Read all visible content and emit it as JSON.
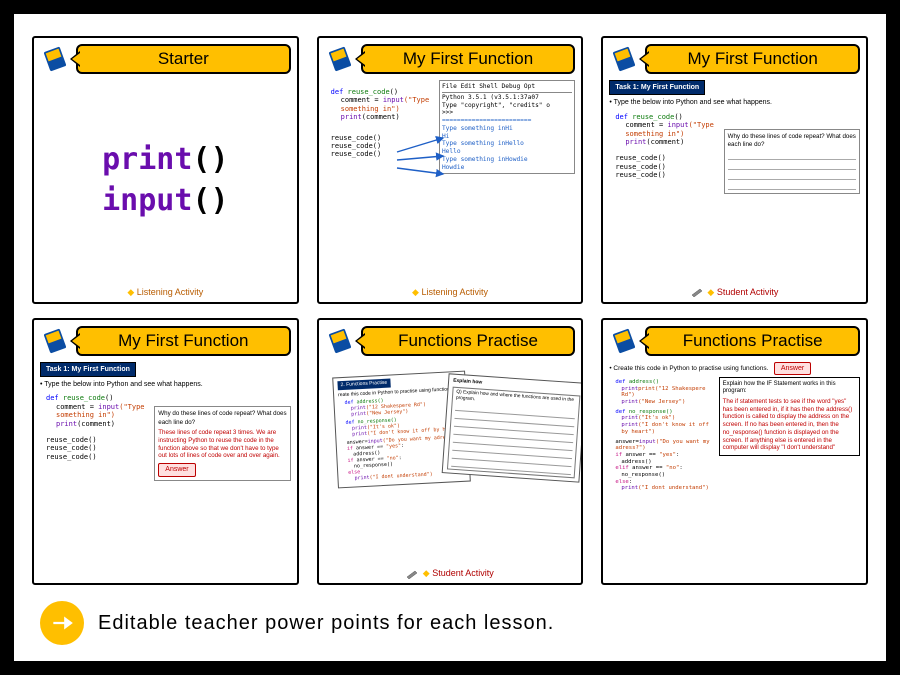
{
  "slides": [
    {
      "title": "Starter",
      "funcs": {
        "f1": "print",
        "f2": "input",
        "par": "()"
      },
      "footer": "Listening Activity"
    },
    {
      "title": "My First Function",
      "code_left": {
        "l1a": "def ",
        "l1b": "reuse_code",
        "l1c": "()",
        "l2a": "comment = ",
        "l2b": "input",
        "l2c": "(\"Type something in\")",
        "l3a": "print",
        "l3b": "(comment)",
        "calls": "reuse_code()"
      },
      "ide": {
        "menu": "File  Edit  Shell  Debug  Opt",
        "head1": "Python 3.5.1 (v3.5.1:37a07",
        "head2": "Type \"copyright\", \"credits\" o",
        "prompt": ">>>",
        "sep": "========================",
        "l1": "Type something inHi",
        "l2": "Hi",
        "l3": "Type something inHello",
        "l4": "Hello",
        "l5": "Type something inHowdie",
        "l6": "Howdie"
      },
      "footer": "Listening Activity"
    },
    {
      "title": "My First Function",
      "task": "Task 1: My First Function",
      "bullet": "Type the below into Python and see what happens.",
      "question": "Why do these lines of code repeat?  What does each line do?",
      "footer": "Student Activity"
    },
    {
      "title": "My First Function",
      "task": "Task 1: My First Function",
      "bullet": "Type the below into Python and see what happens.",
      "question": "Why do these lines of code repeat?  What does each line do?",
      "answer_text": "These lines of code repeat 3 times. We are instructing Python to reuse the code in the function above so that we don't have to type out lots of lines of code over and over again.",
      "answer_btn": "Answer",
      "footer": ""
    },
    {
      "title": "Functions Practise",
      "sheet_task": "2. Functions Practise",
      "sheet_l1": "reate this code in Python to practise using function",
      "sheet_l2": "Q) Explain how and where the functions are used in the program.",
      "sheet_explain": "Explain how",
      "code": {
        "d1": "def address()",
        "p1": "print(\"12 Shakespere Rd\")",
        "p2": "print(\"New Jersey\")",
        "d2": "def no_response()",
        "p3": "print(\"It's ok\")",
        "p4": "print(\"I don't know it off by hear\")",
        "a1": "answer=input(\"Do you want my adress?\")",
        "if1": "if answer == \"yes\":",
        "c1": "address()",
        "if2": "if answer == \"no\":",
        "c2": "no_response()",
        "el": "else",
        "p5": "print(\"I dont understand\")"
      },
      "footer": "Student Activity"
    },
    {
      "title": "Functions Practise",
      "bullet": "Create this code in Python to practise using functions.",
      "answer_btn": "Answer",
      "explain_title": "Explain how the IF Statement works in this program:",
      "explain_body": "The if statement tests to see if the word \"yes\" has been entered in, if it has then the address() function is called to display the address on the screen. If no has been entered in, then the no_response() function is displayed on the screen. If anything else is entered in the computer will display \"I don't understand\"",
      "code": {
        "d1": "def address()",
        "p1": "print(\"12 Shakespere Rd\")",
        "p2": "print(\"New Jersey\")",
        "d2": "def no_response()",
        "p3": "print(\"It's ok\")",
        "p4": "print(\"I don't know it off by heart\")",
        "a1": "answer=input(\"Do you want my adress?\")",
        "if1": "if answer == \"yes\":",
        "c1": "address()",
        "if2": "elif answer == \"no\":",
        "c2": "no_response()",
        "el": "else:",
        "p5": "print(\"I dont understand\")"
      },
      "footer": ""
    }
  ],
  "caption": "Editable teacher power points for each lesson."
}
